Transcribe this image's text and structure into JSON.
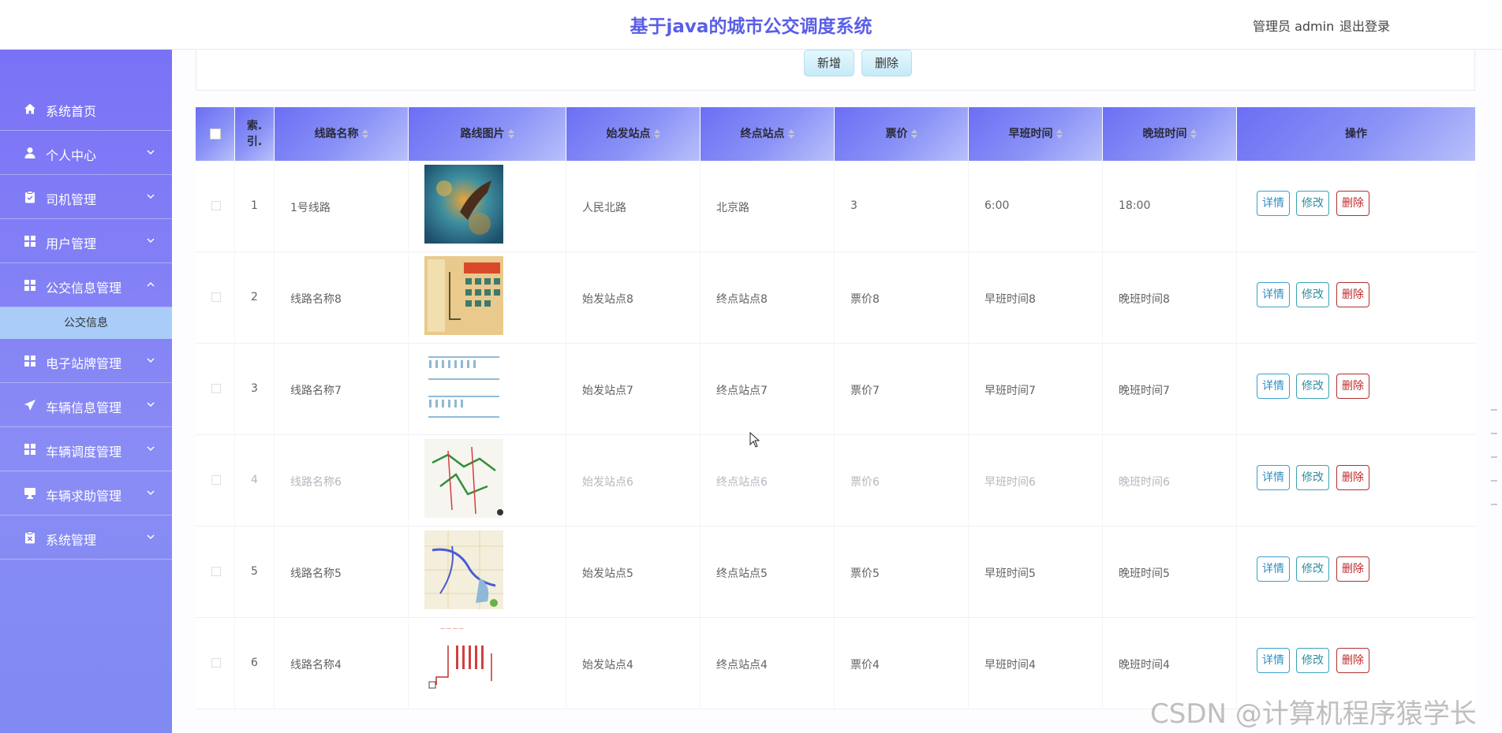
{
  "header": {
    "title": "基于java的城市公交调度系统",
    "user": "管理员 admin",
    "logout": "退出登录"
  },
  "sidebar": {
    "items": [
      {
        "label": "系统首页",
        "icon": "home-icon",
        "arrow": ""
      },
      {
        "label": "个人中心",
        "icon": "user-icon",
        "arrow": "down"
      },
      {
        "label": "司机管理",
        "icon": "clipboard-icon",
        "arrow": "down"
      },
      {
        "label": "用户管理",
        "icon": "grid-icon",
        "arrow": "down"
      },
      {
        "label": "公交信息管理",
        "icon": "grid-icon",
        "arrow": "up"
      },
      {
        "label": "电子站牌管理",
        "icon": "grid-icon",
        "arrow": "down"
      },
      {
        "label": "车辆信息管理",
        "icon": "send-icon",
        "arrow": "down"
      },
      {
        "label": "车辆调度管理",
        "icon": "grid-icon",
        "arrow": "down"
      },
      {
        "label": "车辆求助管理",
        "icon": "monitor-icon",
        "arrow": "down"
      },
      {
        "label": "系统管理",
        "icon": "clipboard-x-icon",
        "arrow": "down"
      }
    ],
    "submenu": {
      "label": "公交信息"
    }
  },
  "toolbar": {
    "add_label": "新增",
    "delete_label": "删除"
  },
  "table": {
    "headers": {
      "index": "索引",
      "index_line1": "索.",
      "index_line2": "引.",
      "name": "线路名称",
      "image": "路线图片",
      "start": "始发站点",
      "end": "终点站点",
      "price": "票价",
      "morning": "早班时间",
      "evening": "晚班时间",
      "ops": "操作"
    },
    "rows": [
      {
        "index": "1",
        "name": "1号线路",
        "start": "人民北路",
        "end": "北京路",
        "price": "3",
        "morning": "6:00",
        "evening": "18:00"
      },
      {
        "index": "2",
        "name": "线路名称8",
        "start": "始发站点8",
        "end": "终点站点8",
        "price": "票价8",
        "morning": "早班时间8",
        "evening": "晚班时间8"
      },
      {
        "index": "3",
        "name": "线路名称7",
        "start": "始发站点7",
        "end": "终点站点7",
        "price": "票价7",
        "morning": "早班时间7",
        "evening": "晚班时间7"
      },
      {
        "index": "4",
        "name": "线路名称6",
        "start": "始发站点6",
        "end": "终点站点6",
        "price": "票价6",
        "morning": "早班时间6",
        "evening": "晚班时间6"
      },
      {
        "index": "5",
        "name": "线路名称5",
        "start": "始发站点5",
        "end": "终点站点5",
        "price": "票价5",
        "morning": "早班时间5",
        "evening": "晚班时间5"
      },
      {
        "index": "6",
        "name": "线路名称4",
        "start": "始发站点4",
        "end": "终点站点4",
        "price": "票价4",
        "morning": "早班时间4",
        "evening": "晚班时间4"
      }
    ],
    "actions": {
      "detail": "详情",
      "edit": "修改",
      "delete": "删除"
    }
  },
  "watermark": "CSDN @计算机程序猿学长",
  "colors": {
    "brand": "#5a5ee8",
    "sidebar": "#7a72f6",
    "submenu": "#a9cdf8",
    "danger": "#c02a2a"
  }
}
